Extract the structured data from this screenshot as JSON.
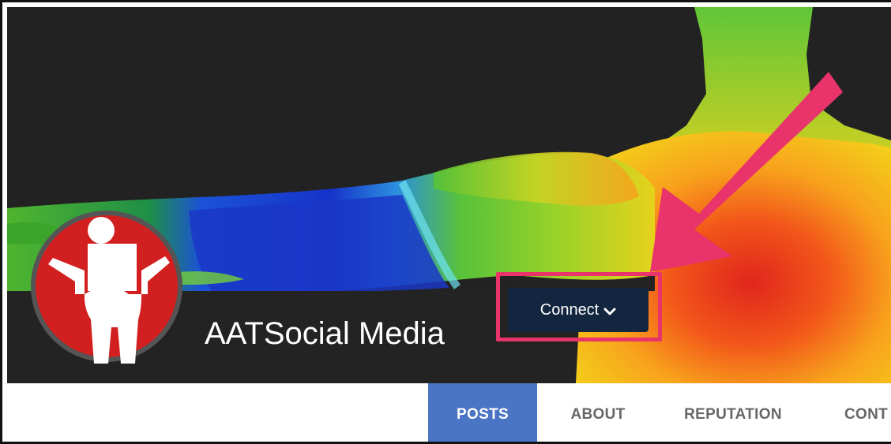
{
  "profile": {
    "name": "AATSocial Media",
    "avatar_icon": "accessibility-person-icon"
  },
  "connect": {
    "label": "Connect",
    "icon": "chevron-down-icon"
  },
  "annotation": {
    "arrow_icon": "pointer-arrow-icon",
    "highlight_color": "#e8336b"
  },
  "tabs": [
    {
      "label": "POSTS",
      "active": true
    },
    {
      "label": "ABOUT",
      "active": false
    },
    {
      "label": "REPUTATION",
      "active": false
    },
    {
      "label": "CONT",
      "active": false
    }
  ],
  "colors": {
    "accent": "#4a74c4",
    "button": "#13263f",
    "avatar_red": "#d21f1f"
  }
}
